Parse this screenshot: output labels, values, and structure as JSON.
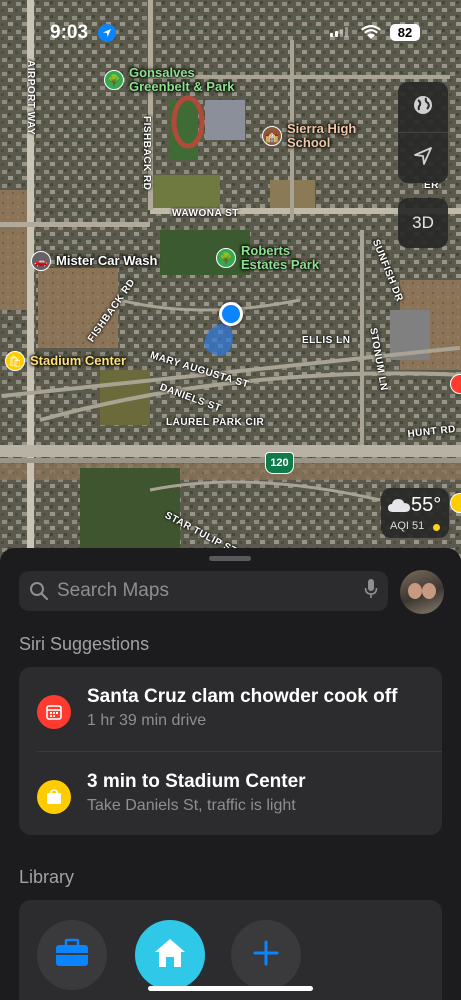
{
  "status_bar": {
    "time": "9:03",
    "battery": "82"
  },
  "map": {
    "places": [
      {
        "name": "Gonsalves\nGreenbelt & Park",
        "key": "gonsalves"
      },
      {
        "name": "Sierra High\nSchool",
        "key": "sierra"
      },
      {
        "name": "Roberts\nEstates Park",
        "key": "roberts"
      },
      {
        "name": "Mister Car Wash",
        "key": "carwash"
      },
      {
        "name": "Stadium Center",
        "key": "stadium"
      }
    ],
    "streets": {
      "airport_way": "AIRPORT WAY",
      "fishback_rd_top": "FISHBACK RD",
      "wawona_st": "WAWONA ST",
      "sunfish_dr": "SUNFISH DR",
      "fishback_rd_left": "FISHBACK RD",
      "ellis_ln": "ELLIS LN",
      "stonum_ln": "STONUM LN",
      "mary_augusta_st": "MARY AUGUSTA ST",
      "daniels_st": "DANIELS ST",
      "laurel_park_cir": "LAUREL PARK CIR",
      "hunt_rd": "HUNT RD",
      "star_tulip_st": "STAR TULIP ST",
      "right_edge": "ER"
    },
    "route_shield": "120",
    "controls": {
      "three_d_label": "3D"
    },
    "weather": {
      "temp": "55°",
      "aqi": "AQI 51",
      "aqi_color": "#ffd60a"
    }
  },
  "sheet": {
    "search_placeholder": "Search Maps",
    "siri_title": "Siri Suggestions",
    "suggestions": [
      {
        "title": "Santa Cruz clam chowder cook off",
        "subtitle": "1 hr 39 min drive",
        "icon": "calendar-icon",
        "color": "#ff3b30"
      },
      {
        "title": "3 min to Stadium Center",
        "subtitle": "Take Daniels St, traffic is light",
        "icon": "shopping-bag-icon",
        "color": "#ffcc00"
      }
    ],
    "library_title": "Library",
    "library": [
      {
        "name": "work",
        "icon": "briefcase-icon"
      },
      {
        "name": "home",
        "icon": "house-icon"
      },
      {
        "name": "add",
        "icon": "plus-icon"
      }
    ]
  },
  "colors": {
    "accent": "#0a84ff",
    "park": "#34a853",
    "home_bg": "#30c8e8"
  }
}
